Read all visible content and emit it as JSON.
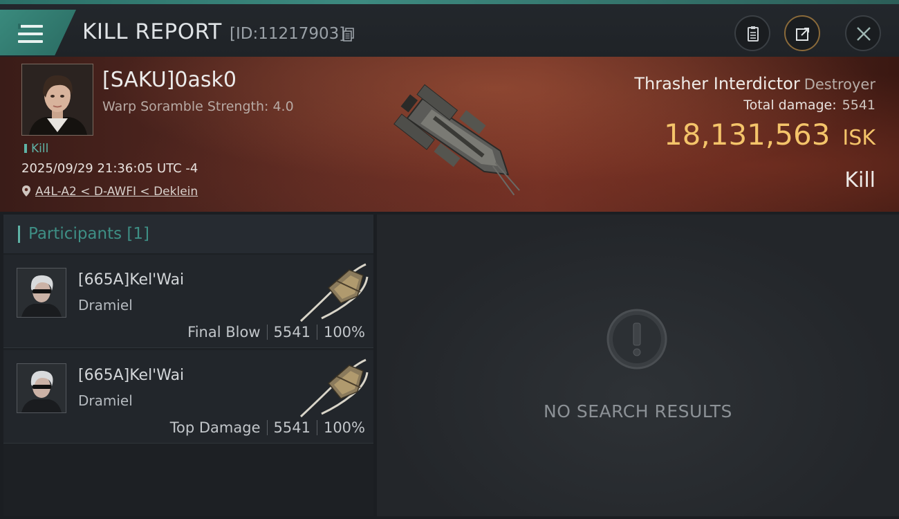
{
  "header": {
    "title": "KILL REPORT",
    "id_label": "[ID:11217903]"
  },
  "victim": {
    "name": "[SAKU]0ask0",
    "subtitle": "Warp Soramble Strength: 4.0",
    "tag": "Kill",
    "datetime": "2025/09/29 21:36:05 UTC -4",
    "location": "A4L-A2 < D-AWFI < Deklein"
  },
  "ship": {
    "name": "Thrasher Interdictor",
    "class": "Destroyer",
    "total_damage_label": "Total damage:",
    "total_damage": "5541",
    "isk_value": "18,131,563",
    "isk_unit": "ISK",
    "result": "Kill"
  },
  "participants": {
    "header": "Participants [1]",
    "rows": [
      {
        "name": "[665A]Kel'Wai",
        "ship": "Dramiel",
        "role": "Final Blow",
        "damage": "5541",
        "percent": "100%"
      },
      {
        "name": "[665A]Kel'Wai",
        "ship": "Dramiel",
        "role": "Top Damage",
        "damage": "5541",
        "percent": "100%"
      }
    ]
  },
  "results": {
    "empty_text": "NO SEARCH RESULTS"
  },
  "colors": {
    "accent": "#3a8a7d",
    "isk": "#f4c46a",
    "hero_bg": "#5a2a22"
  },
  "icons": {
    "menu": "menu-icon",
    "copy": "copy-icon",
    "clipboard": "clipboard-icon",
    "export": "export-icon",
    "close": "close-icon",
    "location": "location-pin-icon",
    "empty": "exclamation-icon"
  }
}
